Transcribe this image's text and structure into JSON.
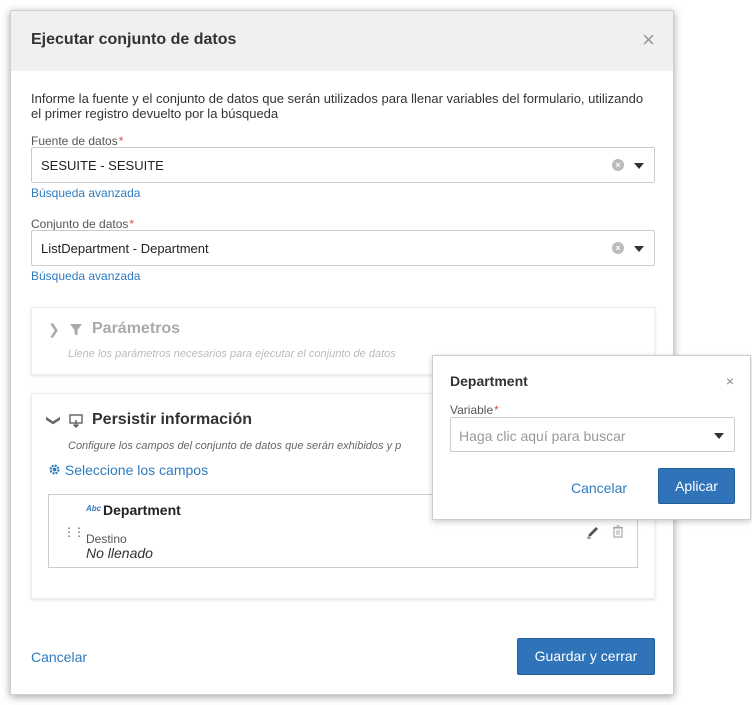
{
  "dialog": {
    "title": "Ejecutar conjunto de datos",
    "close_icon": "×",
    "intro": "Informe la fuente y el conjunto de datos que serán utilizados para llenar variables del formulario, utilizando el primer registro devuelto por la búsqueda",
    "data_source": {
      "label": "Fuente de datos",
      "required": "*",
      "value": "SESUITE - SESUITE",
      "advanced_search": "Búsqueda avanzada"
    },
    "dataset": {
      "label": "Conjunto de datos",
      "required": "*",
      "value": "ListDepartment - Department",
      "advanced_search": "Búsqueda avanzada"
    },
    "parameters": {
      "title": "Parámetros",
      "subtitle": "Llene los parámetros necesarios para ejecutar el conjunto de datos"
    },
    "persist": {
      "title": "Persistir información",
      "subtitle": "Configure los campos del conjunto de datos que serán exhibidos y p",
      "select_fields": "Seleccione los campos",
      "field": {
        "type_badge": "Abc",
        "name": "Department",
        "dest_label": "Destino",
        "dest_value": "No llenado"
      }
    },
    "footer": {
      "cancel": "Cancelar",
      "save": "Guardar y cerrar"
    }
  },
  "popover": {
    "title": "Department",
    "close_icon": "×",
    "variable_label": "Variable",
    "required": "*",
    "placeholder": "Haga clic aquí para buscar",
    "cancel": "Cancelar",
    "apply": "Aplicar"
  },
  "colors": {
    "accent": "#2f7bbf",
    "primary_button": "#2f73b8",
    "required": "#d9534f",
    "header_bg": "#f0f0f0"
  }
}
